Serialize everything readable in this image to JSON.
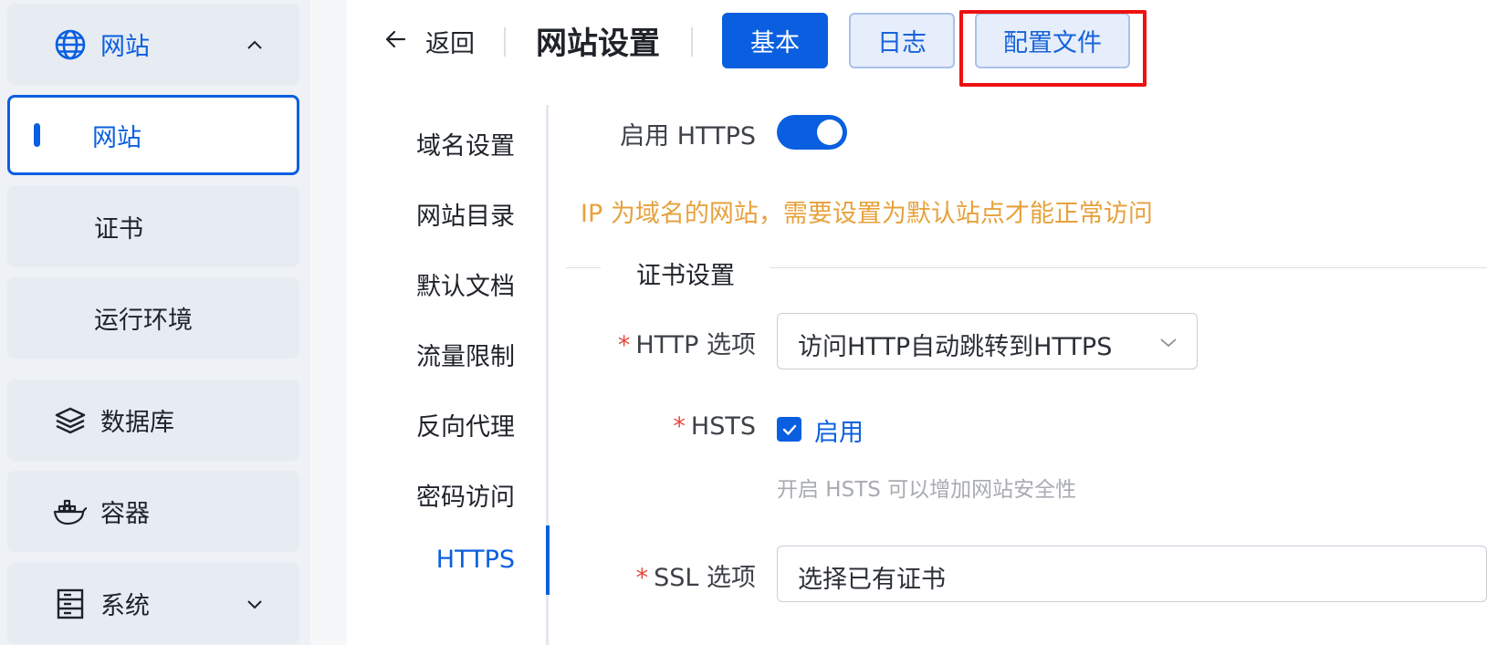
{
  "sidebar": {
    "website_group": {
      "label": "网站",
      "icon": "globe-icon"
    },
    "items": [
      {
        "label": "网站",
        "active": true
      },
      {
        "label": "证书"
      },
      {
        "label": "运行环境"
      }
    ],
    "database": {
      "label": "数据库",
      "icon": "layers-icon"
    },
    "container": {
      "label": "容器",
      "icon": "docker-icon"
    },
    "system": {
      "label": "系统",
      "icon": "server-icon"
    }
  },
  "header": {
    "back_label": "返回",
    "title": "网站设置",
    "tabs": [
      {
        "label": "基本",
        "active": true
      },
      {
        "label": "日志"
      },
      {
        "label": "配置文件"
      }
    ]
  },
  "subnav": {
    "items": [
      {
        "label": "域名设置"
      },
      {
        "label": "网站目录"
      },
      {
        "label": "默认文档"
      },
      {
        "label": "流量限制"
      },
      {
        "label": "反向代理"
      },
      {
        "label": "密码访问"
      },
      {
        "label": "HTTPS",
        "active": true
      }
    ]
  },
  "form": {
    "https_label": "启用 HTTPS",
    "https_enabled": true,
    "warning": "IP 为域名的网站，需要设置为默认站点才能正常访问",
    "section_title": "证书设置",
    "http_option_label": "HTTP 选项",
    "http_option_value": "访问HTTP自动跳转到HTTPS",
    "hsts_label": "HSTS",
    "hsts_checkbox_label": "启用",
    "hsts_checked": true,
    "hsts_hint": "开启 HSTS 可以增加网站安全性",
    "ssl_option_label": "SSL 选项",
    "ssl_option_value": "选择已有证书",
    "required_mark": "*"
  },
  "colors": {
    "primary": "#0a5fe0",
    "warning": "#e6a23c",
    "highlight": "#ee1111"
  }
}
